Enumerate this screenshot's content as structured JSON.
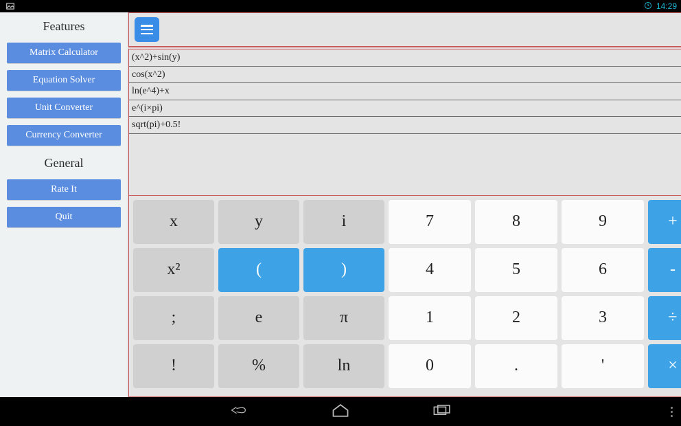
{
  "status": {
    "time": "14:29"
  },
  "sidebar": {
    "features_heading": "Features",
    "general_heading": "General",
    "features": [
      {
        "label": "Matrix Calculator"
      },
      {
        "label": "Equation Solver"
      },
      {
        "label": "Unit Converter"
      },
      {
        "label": "Currency Converter"
      }
    ],
    "general": [
      {
        "label": "Rate It"
      },
      {
        "label": "Quit"
      }
    ]
  },
  "history": [
    "(x^2)+sin(y)",
    "cos(x^2)",
    "ln(e^4)+x",
    "e^(i×pi)",
    "sqrt(pi)+0.5!"
  ],
  "keypad": {
    "rows": [
      [
        {
          "label": "x",
          "style": "gray"
        },
        {
          "label": "y",
          "style": "gray"
        },
        {
          "label": "i",
          "style": "gray"
        },
        {
          "label": "7",
          "style": "white"
        },
        {
          "label": "8",
          "style": "white"
        },
        {
          "label": "9",
          "style": "white"
        },
        {
          "label": "+",
          "style": "blue"
        }
      ],
      [
        {
          "label": "x²",
          "style": "gray"
        },
        {
          "label": "(",
          "style": "blue"
        },
        {
          "label": ")",
          "style": "blue"
        },
        {
          "label": "4",
          "style": "white"
        },
        {
          "label": "5",
          "style": "white"
        },
        {
          "label": "6",
          "style": "white"
        },
        {
          "label": "-",
          "style": "blue"
        }
      ],
      [
        {
          "label": ";",
          "style": "gray"
        },
        {
          "label": "e",
          "style": "gray"
        },
        {
          "label": "π",
          "style": "gray"
        },
        {
          "label": "1",
          "style": "white"
        },
        {
          "label": "2",
          "style": "white"
        },
        {
          "label": "3",
          "style": "white"
        },
        {
          "label": "÷",
          "style": "blue"
        }
      ],
      [
        {
          "label": "!",
          "style": "gray"
        },
        {
          "label": "%",
          "style": "gray"
        },
        {
          "label": "ln",
          "style": "gray"
        },
        {
          "label": "0",
          "style": "white"
        },
        {
          "label": ".",
          "style": "white"
        },
        {
          "label": "'",
          "style": "white"
        },
        {
          "label": "×",
          "style": "blue"
        }
      ]
    ]
  }
}
